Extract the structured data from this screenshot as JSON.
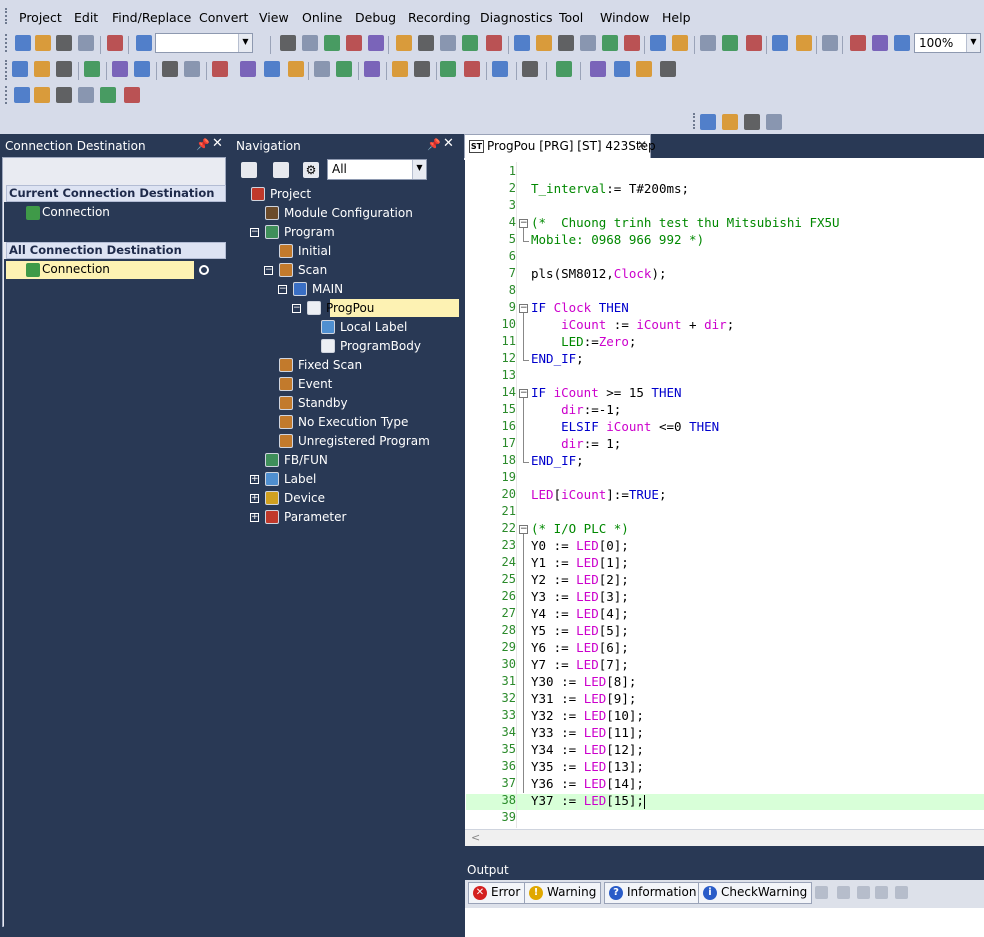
{
  "menu": [
    "Project",
    "Edit",
    "Find/Replace",
    "Convert",
    "View",
    "Online",
    "Debug",
    "Recording",
    "Diagnostics",
    "Tool",
    "Window",
    "Help"
  ],
  "toolbar": {
    "zoom": "100%",
    "program_filter": ""
  },
  "colors": {
    "background": "#293955",
    "menubar": "#d6dbe9",
    "selection": "#fdf2b3",
    "keyword": "#0000cc",
    "variable": "#cc00cc",
    "comment": "#008800",
    "line_number": "#2a8a2a",
    "current_line": "#d8ffd8"
  },
  "connection_panel": {
    "title": "Connection Destination",
    "current_header": "Current Connection Destination",
    "current_item": "Connection",
    "all_header": "All Connection Destination",
    "all_item": "Connection"
  },
  "navigation_panel": {
    "title": "Navigation",
    "filter": "All",
    "tree": [
      {
        "label": "Project",
        "icon": "project-icon",
        "indent": 0,
        "toggle": ""
      },
      {
        "label": "Module Configuration",
        "icon": "module-config-icon",
        "indent": 1,
        "toggle": ""
      },
      {
        "label": "Program",
        "icon": "program-folder-icon",
        "indent": 1,
        "toggle": "−"
      },
      {
        "label": "Initial",
        "icon": "task-icon",
        "indent": 2,
        "toggle": ""
      },
      {
        "label": "Scan",
        "icon": "task-icon",
        "indent": 2,
        "toggle": "−"
      },
      {
        "label": "MAIN",
        "icon": "program-file-icon",
        "indent": 3,
        "toggle": "−"
      },
      {
        "label": "ProgPou",
        "icon": "st-file-icon",
        "indent": 4,
        "toggle": "−",
        "selected": true
      },
      {
        "label": "Local Label",
        "icon": "local-label-icon",
        "indent": 5,
        "toggle": ""
      },
      {
        "label": "ProgramBody",
        "icon": "st-body-icon",
        "indent": 5,
        "toggle": ""
      },
      {
        "label": "Fixed Scan",
        "icon": "task-icon",
        "indent": 2,
        "toggle": ""
      },
      {
        "label": "Event",
        "icon": "task-icon",
        "indent": 2,
        "toggle": ""
      },
      {
        "label": "Standby",
        "icon": "task-icon",
        "indent": 2,
        "toggle": ""
      },
      {
        "label": "No Execution Type",
        "icon": "task-icon",
        "indent": 2,
        "toggle": ""
      },
      {
        "label": "Unregistered Program",
        "icon": "task-icon",
        "indent": 2,
        "toggle": ""
      },
      {
        "label": "FB/FUN",
        "icon": "fbfun-icon",
        "indent": 1,
        "toggle": ""
      },
      {
        "label": "Label",
        "icon": "label-icon",
        "indent": 1,
        "toggle": "+"
      },
      {
        "label": "Device",
        "icon": "device-icon",
        "indent": 1,
        "toggle": "+"
      },
      {
        "label": "Parameter",
        "icon": "parameter-icon",
        "indent": 1,
        "toggle": "+"
      }
    ]
  },
  "editor": {
    "tab_label": "ProgPou [PRG] [ST] 423Step",
    "lines": [
      {
        "n": "1",
        "t": []
      },
      {
        "n": "2",
        "t": [
          [
            "T_interval",
            "cm"
          ],
          [
            ":= T#200ms;",
            ""
          ]
        ]
      },
      {
        "n": "3",
        "t": []
      },
      {
        "n": "4",
        "t": [
          [
            "(*  Chuong trinh test thu Mitsubishi FX5U",
            "cm"
          ]
        ],
        "fold": "start"
      },
      {
        "n": "5",
        "t": [
          [
            "Mobile: 0968 966 992 *)",
            "cm"
          ]
        ],
        "fold": "end"
      },
      {
        "n": "6",
        "t": []
      },
      {
        "n": "7",
        "t": [
          [
            "pls(SM8012,",
            ""
          ],
          [
            "Clock",
            "var"
          ],
          [
            ");",
            ""
          ]
        ]
      },
      {
        "n": "8",
        "t": []
      },
      {
        "n": "9",
        "t": [
          [
            "IF ",
            "kw"
          ],
          [
            "Clock ",
            "var"
          ],
          [
            "THEN",
            "kw"
          ]
        ],
        "fold": "start"
      },
      {
        "n": "10",
        "t": [
          [
            "    ",
            ""
          ],
          [
            "iCount",
            "var"
          ],
          [
            " := ",
            ""
          ],
          [
            "iCount",
            "var"
          ],
          [
            " + ",
            ""
          ],
          [
            "dir",
            "var"
          ],
          [
            ";",
            ""
          ]
        ],
        "fold": "mid"
      },
      {
        "n": "11",
        "t": [
          [
            "    ",
            ""
          ],
          [
            "LED",
            "cm"
          ],
          [
            ":=",
            ""
          ],
          [
            "Zero",
            "var"
          ],
          [
            ";",
            ""
          ]
        ],
        "fold": "mid"
      },
      {
        "n": "12",
        "t": [
          [
            "END_IF",
            "kw"
          ],
          [
            ";",
            ""
          ]
        ],
        "fold": "end"
      },
      {
        "n": "13",
        "t": []
      },
      {
        "n": "14",
        "t": [
          [
            "IF ",
            "kw"
          ],
          [
            "iCount",
            "var"
          ],
          [
            " >= 15 ",
            ""
          ],
          [
            "THEN",
            "kw"
          ]
        ],
        "fold": "start"
      },
      {
        "n": "15",
        "t": [
          [
            "    ",
            ""
          ],
          [
            "dir",
            "var"
          ],
          [
            ":=-1;",
            ""
          ]
        ],
        "fold": "mid"
      },
      {
        "n": "16",
        "t": [
          [
            "    ",
            ""
          ],
          [
            "ELSIF ",
            "kw"
          ],
          [
            "iCount",
            "var"
          ],
          [
            " <=0 ",
            ""
          ],
          [
            "THEN",
            "kw"
          ]
        ],
        "fold": "mid"
      },
      {
        "n": "17",
        "t": [
          [
            "    ",
            ""
          ],
          [
            "dir",
            "var"
          ],
          [
            ":= 1;",
            ""
          ]
        ],
        "fold": "mid"
      },
      {
        "n": "18",
        "t": [
          [
            "END_IF",
            "kw"
          ],
          [
            ";",
            ""
          ]
        ],
        "fold": "end"
      },
      {
        "n": "19",
        "t": []
      },
      {
        "n": "20",
        "t": [
          [
            "LED",
            "var"
          ],
          [
            "[",
            ""
          ],
          [
            "iCount",
            "var"
          ],
          [
            "]:=",
            ""
          ],
          [
            "TRUE",
            "kw"
          ],
          [
            ";",
            ""
          ]
        ]
      },
      {
        "n": "21",
        "t": []
      },
      {
        "n": "22",
        "t": [
          [
            "(* I/O PLC *)",
            "cm"
          ]
        ],
        "fold": "start"
      },
      {
        "n": "23",
        "t": [
          [
            "Y0 := ",
            ""
          ],
          [
            "LED",
            "var"
          ],
          [
            "[0];",
            ""
          ]
        ],
        "fold": "mid"
      },
      {
        "n": "24",
        "t": [
          [
            "Y1 := ",
            ""
          ],
          [
            "LED",
            "var"
          ],
          [
            "[1];",
            ""
          ]
        ],
        "fold": "mid"
      },
      {
        "n": "25",
        "t": [
          [
            "Y2 := ",
            ""
          ],
          [
            "LED",
            "var"
          ],
          [
            "[2];",
            ""
          ]
        ],
        "fold": "mid"
      },
      {
        "n": "26",
        "t": [
          [
            "Y3 := ",
            ""
          ],
          [
            "LED",
            "var"
          ],
          [
            "[3];",
            ""
          ]
        ],
        "fold": "mid"
      },
      {
        "n": "27",
        "t": [
          [
            "Y4 := ",
            ""
          ],
          [
            "LED",
            "var"
          ],
          [
            "[4];",
            ""
          ]
        ],
        "fold": "mid"
      },
      {
        "n": "28",
        "t": [
          [
            "Y5 := ",
            ""
          ],
          [
            "LED",
            "var"
          ],
          [
            "[5];",
            ""
          ]
        ],
        "fold": "mid"
      },
      {
        "n": "29",
        "t": [
          [
            "Y6 := ",
            ""
          ],
          [
            "LED",
            "var"
          ],
          [
            "[6];",
            ""
          ]
        ],
        "fold": "mid"
      },
      {
        "n": "30",
        "t": [
          [
            "Y7 := ",
            ""
          ],
          [
            "LED",
            "var"
          ],
          [
            "[7];",
            ""
          ]
        ],
        "fold": "mid"
      },
      {
        "n": "31",
        "t": [
          [
            "Y30 := ",
            ""
          ],
          [
            "LED",
            "var"
          ],
          [
            "[8];",
            ""
          ]
        ],
        "fold": "mid"
      },
      {
        "n": "32",
        "t": [
          [
            "Y31 := ",
            ""
          ],
          [
            "LED",
            "var"
          ],
          [
            "[9];",
            ""
          ]
        ],
        "fold": "mid"
      },
      {
        "n": "33",
        "t": [
          [
            "Y32 := ",
            ""
          ],
          [
            "LED",
            "var"
          ],
          [
            "[10];",
            ""
          ]
        ],
        "fold": "mid"
      },
      {
        "n": "34",
        "t": [
          [
            "Y33 := ",
            ""
          ],
          [
            "LED",
            "var"
          ],
          [
            "[11];",
            ""
          ]
        ],
        "fold": "mid"
      },
      {
        "n": "35",
        "t": [
          [
            "Y34 := ",
            ""
          ],
          [
            "LED",
            "var"
          ],
          [
            "[12];",
            ""
          ]
        ],
        "fold": "mid"
      },
      {
        "n": "36",
        "t": [
          [
            "Y35 := ",
            ""
          ],
          [
            "LED",
            "var"
          ],
          [
            "[13];",
            ""
          ]
        ],
        "fold": "mid"
      },
      {
        "n": "37",
        "t": [
          [
            "Y36 := ",
            ""
          ],
          [
            "LED",
            "var"
          ],
          [
            "[14];",
            ""
          ]
        ],
        "fold": "mid"
      },
      {
        "n": "38",
        "t": [
          [
            "Y37 := ",
            ""
          ],
          [
            "LED",
            "var"
          ],
          [
            "[15];",
            ""
          ]
        ],
        "current": true
      },
      {
        "n": "39",
        "t": []
      }
    ]
  },
  "output_panel": {
    "title": "Output",
    "buttons": [
      {
        "label": "Error",
        "icon": "error-icon",
        "color": "#d42020",
        "glyph": "✕"
      },
      {
        "label": "Warning",
        "icon": "warning-icon",
        "color": "#e0a800",
        "glyph": "!"
      },
      {
        "label": "Information",
        "icon": "information-icon",
        "color": "#2a5cc8",
        "glyph": "?"
      },
      {
        "label": "CheckWarning",
        "icon": "check-warning-icon",
        "color": "#2a5cc8",
        "glyph": "i"
      }
    ]
  }
}
